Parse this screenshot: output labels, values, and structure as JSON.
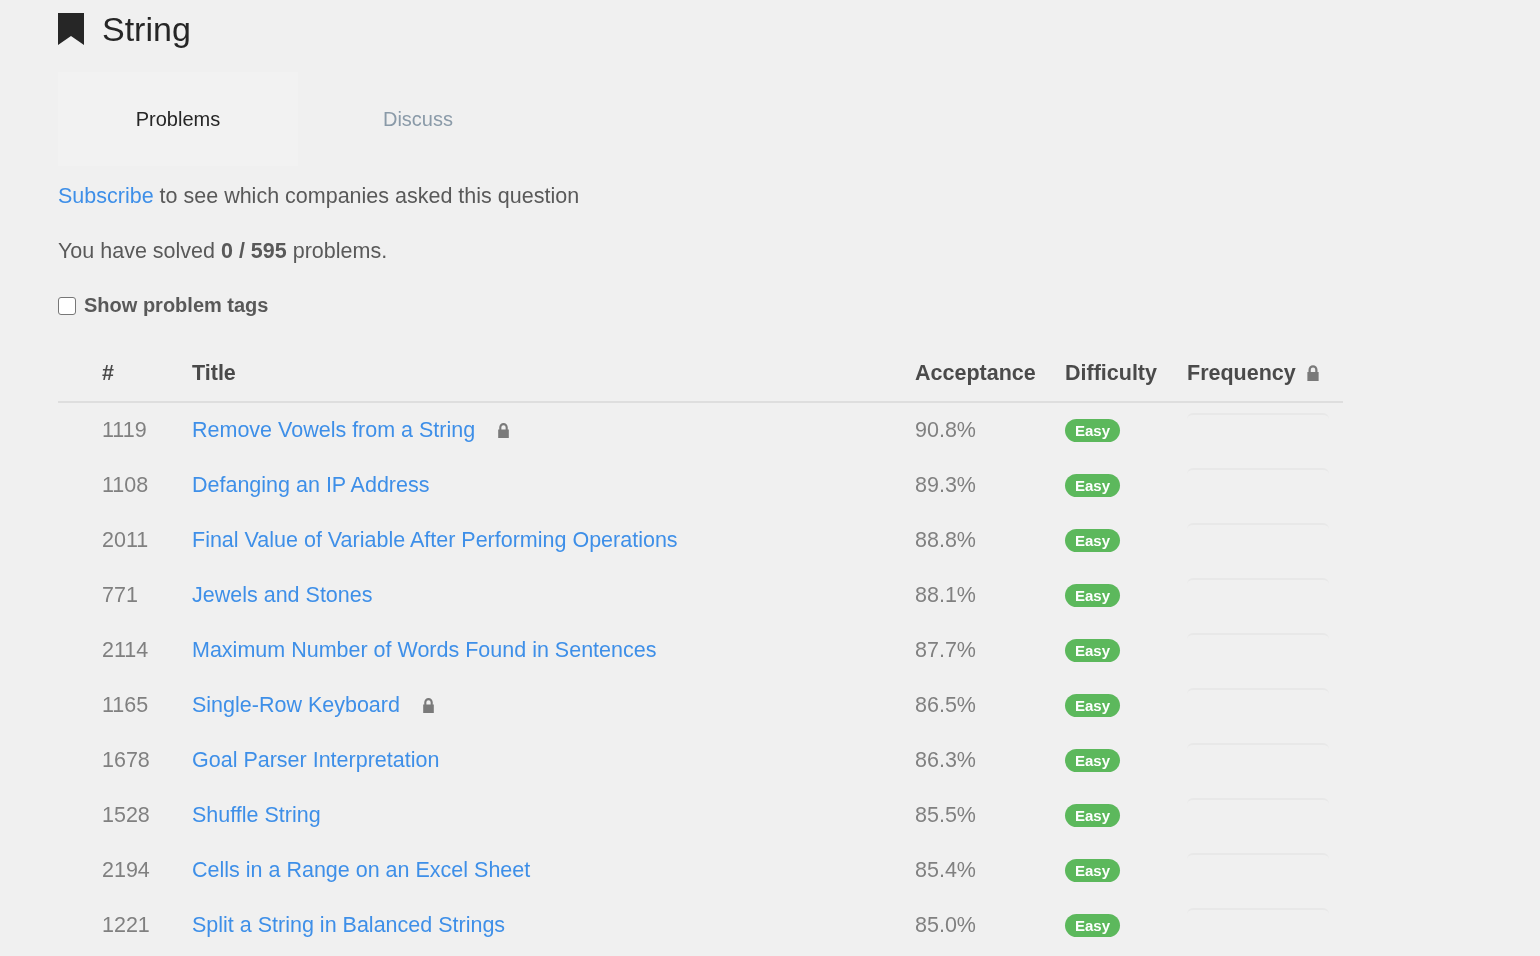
{
  "page": {
    "title": "String"
  },
  "tabs": [
    {
      "label": "Problems",
      "selected": true
    },
    {
      "label": "Discuss",
      "selected": false
    }
  ],
  "subscribe": {
    "link": "Subscribe",
    "text": "to see which companies asked this question"
  },
  "progress": "You have solved **0 / 595** problems.",
  "show_tags": {
    "label": "Show problem tags",
    "checked": false
  },
  "table": {
    "columns": [
      "#",
      "Title",
      "Acceptance",
      "Difficulty",
      "Frequency"
    ],
    "frequency_locked": true,
    "rows": [
      {
        "number": "1119",
        "title": "Remove Vowels from a String",
        "locked": true,
        "acceptance": "90.8%",
        "difficulty": "Easy"
      },
      {
        "number": "1108",
        "title": "Defanging an IP Address",
        "locked": false,
        "acceptance": "89.3%",
        "difficulty": "Easy"
      },
      {
        "number": "2011",
        "title": "Final Value of Variable After Performing Operations",
        "locked": false,
        "acceptance": "88.8%",
        "difficulty": "Easy"
      },
      {
        "number": "771",
        "title": "Jewels and Stones",
        "locked": false,
        "acceptance": "88.1%",
        "difficulty": "Easy"
      },
      {
        "number": "2114",
        "title": "Maximum Number of Words Found in Sentences",
        "locked": false,
        "acceptance": "87.7%",
        "difficulty": "Easy"
      },
      {
        "number": "1165",
        "title": "Single-Row Keyboard",
        "locked": true,
        "acceptance": "86.5%",
        "difficulty": "Easy"
      },
      {
        "number": "1678",
        "title": "Goal Parser Interpretation",
        "locked": false,
        "acceptance": "86.3%",
        "difficulty": "Easy"
      },
      {
        "number": "1528",
        "title": "Shuffle String",
        "locked": false,
        "acceptance": "85.5%",
        "difficulty": "Easy"
      },
      {
        "number": "2194",
        "title": "Cells in a Range on an Excel Sheet",
        "locked": false,
        "acceptance": "85.4%",
        "difficulty": "Easy"
      },
      {
        "number": "1221",
        "title": "Split a String in Balanced Strings",
        "locked": false,
        "acceptance": "85.0%",
        "difficulty": "Easy"
      }
    ]
  }
}
